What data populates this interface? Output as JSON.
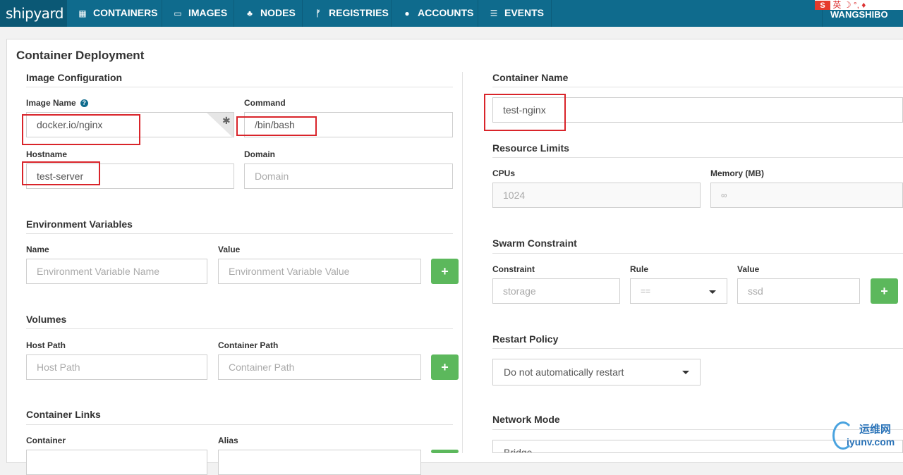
{
  "nav": {
    "brand": "shipyard",
    "items": [
      {
        "label": "CONTAINERS",
        "icon": "grid-icon"
      },
      {
        "label": "IMAGES",
        "icon": "hdd-icon"
      },
      {
        "label": "NODES",
        "icon": "sitemap-icon"
      },
      {
        "label": "REGISTRIES",
        "icon": "branch-icon"
      },
      {
        "label": "ACCOUNTS",
        "icon": "user-icon"
      },
      {
        "label": "EVENTS",
        "icon": "list-icon"
      }
    ],
    "user": "WANGSHIBO",
    "ime_glyph": "英"
  },
  "page": {
    "title": "Container Deployment"
  },
  "image_config": {
    "heading": "Image Configuration",
    "image_name": {
      "label": "Image Name",
      "value": "docker.io/nginx"
    },
    "command": {
      "label": "Command",
      "value": "/bin/bash"
    },
    "hostname": {
      "label": "Hostname",
      "value": "test-server"
    },
    "domain": {
      "label": "Domain",
      "placeholder": "Domain"
    }
  },
  "env": {
    "heading": "Environment Variables",
    "name_label": "Name",
    "value_label": "Value",
    "name_placeholder": "Environment Variable Name",
    "value_placeholder": "Environment Variable Value",
    "add": "+"
  },
  "volumes": {
    "heading": "Volumes",
    "host_label": "Host Path",
    "container_label": "Container Path",
    "host_placeholder": "Host Path",
    "container_placeholder": "Container Path",
    "add": "+"
  },
  "links": {
    "heading": "Container Links",
    "container_label": "Container",
    "alias_label": "Alias"
  },
  "container_name": {
    "heading": "Container Name",
    "value": "test-nginx"
  },
  "resources": {
    "heading": "Resource Limits",
    "cpus_label": "CPUs",
    "cpus_placeholder": "1024",
    "memory_label": "Memory (MB)",
    "memory_placeholder": "∞"
  },
  "swarm": {
    "heading": "Swarm Constraint",
    "constraint_label": "Constraint",
    "constraint_placeholder": "storage",
    "rule_label": "Rule",
    "rule_value": "==",
    "value_label": "Value",
    "value_placeholder": "ssd",
    "add": "+"
  },
  "restart": {
    "heading": "Restart Policy",
    "value": "Do not automatically restart"
  },
  "network": {
    "heading": "Network Mode",
    "value": "Bridge"
  },
  "watermark": {
    "top": "运维网",
    "bottom": "iyunv.com"
  },
  "colors": {
    "nav": "#0f6b8d",
    "success": "#5cb85c",
    "highlight": "#d9242a"
  }
}
